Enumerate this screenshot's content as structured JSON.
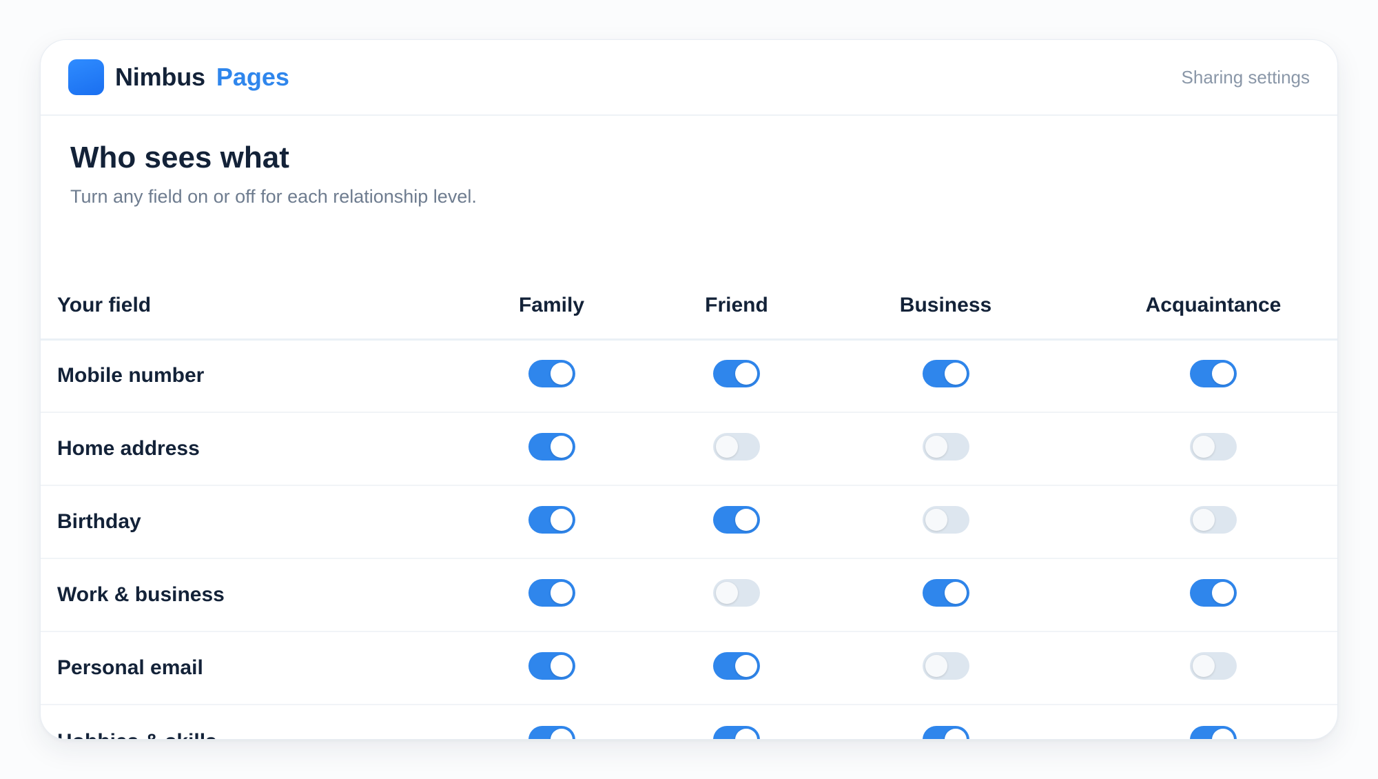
{
  "app": {
    "name": "Nimbus",
    "product": "Pages",
    "link_label": "Sharing settings",
    "accent_color": "#2f86ec"
  },
  "page": {
    "title": "Who sees what",
    "subtitle": "Turn any field on or off for each relationship level."
  },
  "table": {
    "field_header": "Your field",
    "columns": [
      "Family",
      "Friend",
      "Business",
      "Acquaintance"
    ],
    "rows": [
      {
        "field": "Mobile number",
        "toggles": [
          true,
          true,
          true,
          true
        ]
      },
      {
        "field": "Home address",
        "toggles": [
          true,
          false,
          false,
          false
        ]
      },
      {
        "field": "Birthday",
        "toggles": [
          true,
          true,
          false,
          false
        ]
      },
      {
        "field": "Work & business",
        "toggles": [
          true,
          false,
          true,
          true
        ]
      },
      {
        "field": "Personal email",
        "toggles": [
          true,
          true,
          false,
          false
        ]
      },
      {
        "field": "Hobbies & skills",
        "toggles": [
          true,
          true,
          true,
          true
        ]
      }
    ]
  }
}
